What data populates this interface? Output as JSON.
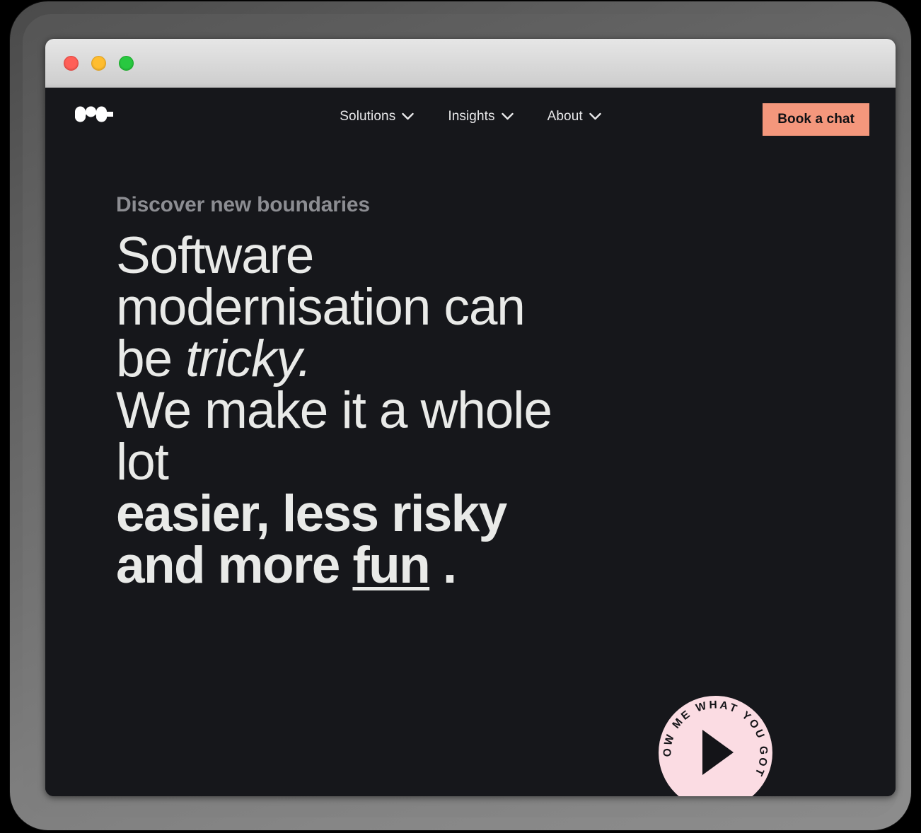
{
  "window": {
    "traffic_lights": [
      {
        "name": "close",
        "color": "#ff5f57"
      },
      {
        "name": "minimize",
        "color": "#ffbd2e"
      },
      {
        "name": "maximize",
        "color": "#28c840"
      }
    ]
  },
  "header": {
    "logo_name": "wave-logo",
    "nav": [
      {
        "label": "Solutions",
        "icon": "chevron-down-icon"
      },
      {
        "label": "Insights",
        "icon": "chevron-down-icon"
      },
      {
        "label": "About",
        "icon": "chevron-down-icon"
      }
    ],
    "cta": {
      "label": "Book a chat",
      "bg": "#f4977c",
      "fg": "#101114"
    }
  },
  "hero": {
    "eyebrow": "Discover new boundaries",
    "headline": {
      "line1": "Software",
      "line2": "modernisation can",
      "line3_plain": "be ",
      "line3_italic": "tricky.",
      "line4": "We make it a whole",
      "line5": "lot",
      "line6_bold": "easier, less risky",
      "line7_bold_a": "and more ",
      "line7_underline": "fun",
      "line7_bold_b": " ."
    }
  },
  "play_badge": {
    "circular_text": "SHOW ME WHAT YOU GOT",
    "icon": "play-icon",
    "bg": "#fbdce3",
    "fg": "#141418"
  },
  "colors": {
    "page_background": "#16171b",
    "text_primary": "#e9eae8",
    "text_muted": "#8c8d92",
    "accent_salmon": "#f4977c",
    "accent_pink": "#fbdce3",
    "titlebar": "#dcdcdc",
    "bezel": "#7d7d7d"
  }
}
